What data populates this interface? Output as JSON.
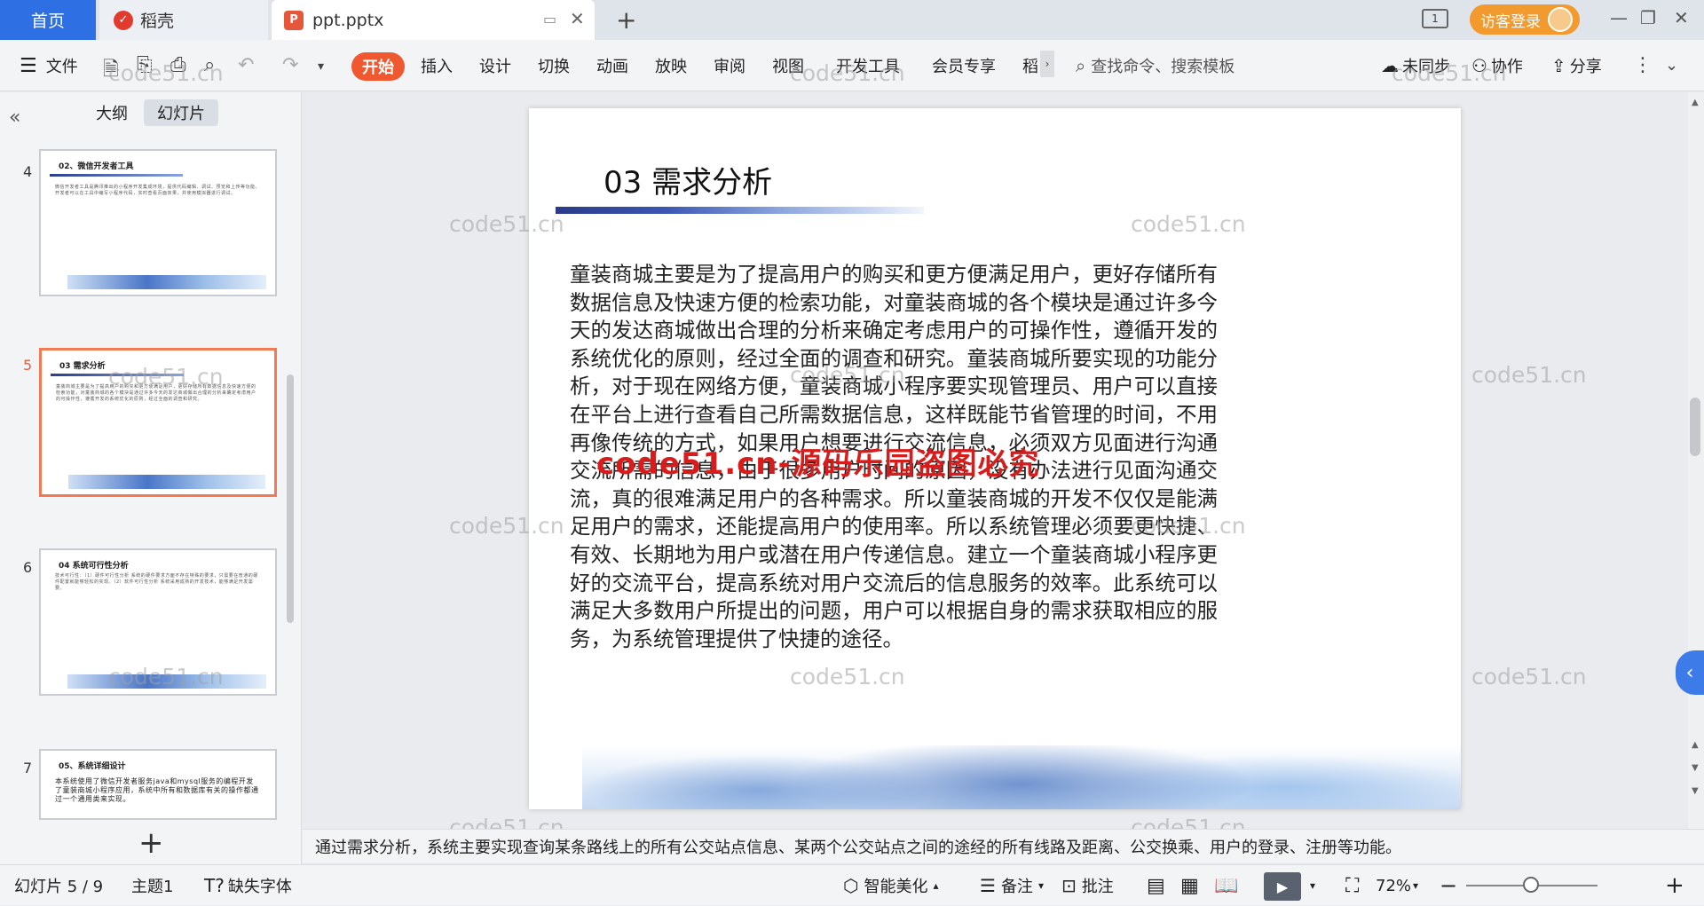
{
  "tabs": {
    "home": "首页",
    "daoke": "稻壳",
    "doc": "ppt.pptx"
  },
  "top_right": {
    "login": "访客登录"
  },
  "ribbon": {
    "file": "文件",
    "tabs": [
      "开始",
      "插入",
      "设计",
      "切换",
      "动画",
      "放映",
      "审阅",
      "视图",
      "开发工具",
      "会员专享",
      "稻"
    ],
    "search_placeholder": "查找命令、搜索模板",
    "sync": "未同步",
    "collab": "协作",
    "share": "分享"
  },
  "left_pane": {
    "tab_outline": "大纲",
    "tab_slides": "幻灯片",
    "thumbs": [
      {
        "num": "4",
        "title": "02、微信开发者工具",
        "body": "微信开发者工具是腾讯推出的小程序开发集成环境，提供代码编辑、调试、预览和上传等功能。开发者可以在工具中编写小程序代码，实时查看页面效果，并使用模拟器进行调试。"
      },
      {
        "num": "5",
        "title": "03 需求分析",
        "body": "童装商城主要是为了提高用户的购买和更方便满足用户，更好存储所有数据信息及快速方便的检索功能，对童装商城的各个模块是通过许多今天的发达商城做出合理的分析来确定考虑用户的可操作性，遵循开发的系统优化的原则，经过全面的调查和研究。"
      },
      {
        "num": "6",
        "title": "04 系统可行性分析",
        "body": "技术可行性：（1）硬件可行性分析 系统的硬件要求方面不存在特殊的要求，只需要在普通的硬件配置就能够轻松的实现。（2）软件可行性分析 系统采用成熟的开发技术，能够满足开发需要。"
      },
      {
        "num": "7",
        "title": "05、系统详细设计",
        "body": "本系统使用了微信开发者服务java和mysql服务的编程开发了童装商城小程序应用，系统中所有和数据库有关的操作都通过一个通用类来实现。"
      }
    ]
  },
  "slide": {
    "title": "03 需求分析",
    "body": "童装商城主要是为了提高用户的购买和更方便满足用户，更好存储所有数据信息及快速方便的检索功能，对童装商城的各个模块是通过许多今天的发达商城做出合理的分析来确定考虑用户的可操作性，遵循开发的系统优化的原则，经过全面的调查和研究。童装商城所要实现的功能分析，对于现在网络方便，童装商城小程序要实现管理员、用户可以直接在平台上进行查看自己所需数据信息，这样既能节省管理的时间，不用再像传统的方式，如果用户想要进行交流信息，必须双方见面进行沟通交流所需的信息，由于很多用户时间的原因，没有办法进行见面沟通交流，真的很难满足用户的各种需求。所以童装商城的开发不仅仅是能满足用户的需求，还能提高用户的使用率。所以系统管理必须要更快捷、有效、长期地为用户或潜在用户传递信息。建立一个童装商城小程序更好的交流平台，提高系统对用户交流后的信息服务的效率。此系统可以满足大多数用户所提出的问题，用户可以根据自身的需求获取相应的服务，为系统管理提供了快捷的途径。"
  },
  "watermarks": {
    "text": "code51.cn",
    "red": "code51.cn-源码乐园盗图必究"
  },
  "notes": "通过需求分析，系统主要实现查询某条路线上的所有公交站点信息、某两个公交站点之间的途经的所有线路及距离、公交换乘、用户的登录、注册等功能。",
  "status": {
    "slide_count": "幻灯片 5 / 9",
    "theme": "主题1",
    "missing_font": "缺失字体",
    "beautify": "智能美化",
    "notes_btn": "备注",
    "comment_btn": "批注",
    "zoom": "72%"
  }
}
